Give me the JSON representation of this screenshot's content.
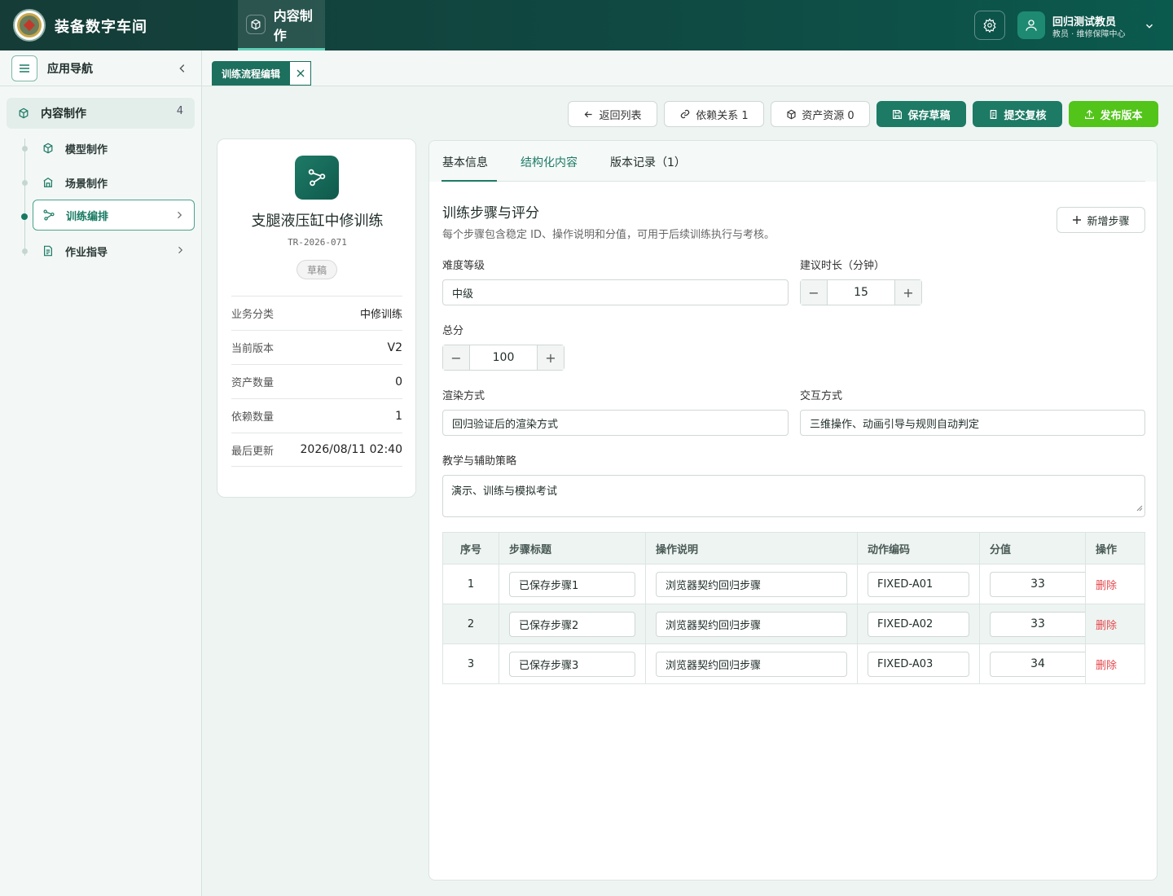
{
  "header": {
    "app_title": "装备数字车间",
    "module_tab": "内容制作",
    "user_name": "回归测试教员",
    "user_role": "教员 · 维修保障中心"
  },
  "sidebar": {
    "title": "应用导航",
    "group": {
      "label": "内容制作",
      "count": "4"
    },
    "items": [
      {
        "label": "模型制作",
        "icon": "cube-icon"
      },
      {
        "label": "场景制作",
        "icon": "building-icon"
      },
      {
        "label": "训练编排",
        "icon": "flow-icon",
        "active": true
      },
      {
        "label": "作业指导",
        "icon": "document-icon"
      }
    ]
  },
  "doc_tab": {
    "label": "训练流程编辑"
  },
  "toolbar": {
    "back": "返回列表",
    "deps": "依赖关系 1",
    "assets": "资产资源 0",
    "save": "保存草稿",
    "submit": "提交复核",
    "publish": "发布版本"
  },
  "card": {
    "title": "支腿液压缸中修训练",
    "code": "TR-2026-071",
    "status": "草稿",
    "fields": [
      {
        "k": "业务分类",
        "v": "中修训练"
      },
      {
        "k": "当前版本",
        "v": "V2"
      },
      {
        "k": "资产数量",
        "v": "0"
      },
      {
        "k": "依赖数量",
        "v": "1"
      },
      {
        "k": "最后更新",
        "v": "2026/08/11 02:40"
      }
    ]
  },
  "panel": {
    "tabs": [
      "基本信息",
      "结构化内容",
      "版本记录（1）"
    ],
    "section_title": "训练步骤与评分",
    "section_sub": "每个步骤包含稳定 ID、操作说明和分值，可用于后续训练执行与考核。",
    "add_step": "新增步骤",
    "difficulty": {
      "label": "难度等级",
      "value": "中级"
    },
    "duration": {
      "label": "建议时长（分钟）",
      "value": "15"
    },
    "total": {
      "label": "总分",
      "value": "100"
    },
    "render": {
      "label": "渲染方式",
      "value": "回归验证后的渲染方式"
    },
    "interaction": {
      "label": "交互方式",
      "value": "三维操作、动画引导与规则自动判定"
    },
    "strategy": {
      "label": "教学与辅助策略",
      "value": "演示、训练与模拟考试"
    },
    "table": {
      "headers": [
        "序号",
        "步骤标题",
        "操作说明",
        "动作编码",
        "分值",
        "操作"
      ],
      "rows": [
        {
          "no": "1",
          "title": "已保存步骤1",
          "desc": "浏览器契约回归步骤",
          "code": "FIXED-A01",
          "score": "33",
          "op": "删除"
        },
        {
          "no": "2",
          "title": "已保存步骤2",
          "desc": "浏览器契约回归步骤",
          "code": "FIXED-A02",
          "score": "33",
          "op": "删除"
        },
        {
          "no": "3",
          "title": "已保存步骤3",
          "desc": "浏览器契约回归步骤",
          "code": "FIXED-A03",
          "score": "34",
          "op": "删除"
        }
      ]
    }
  }
}
